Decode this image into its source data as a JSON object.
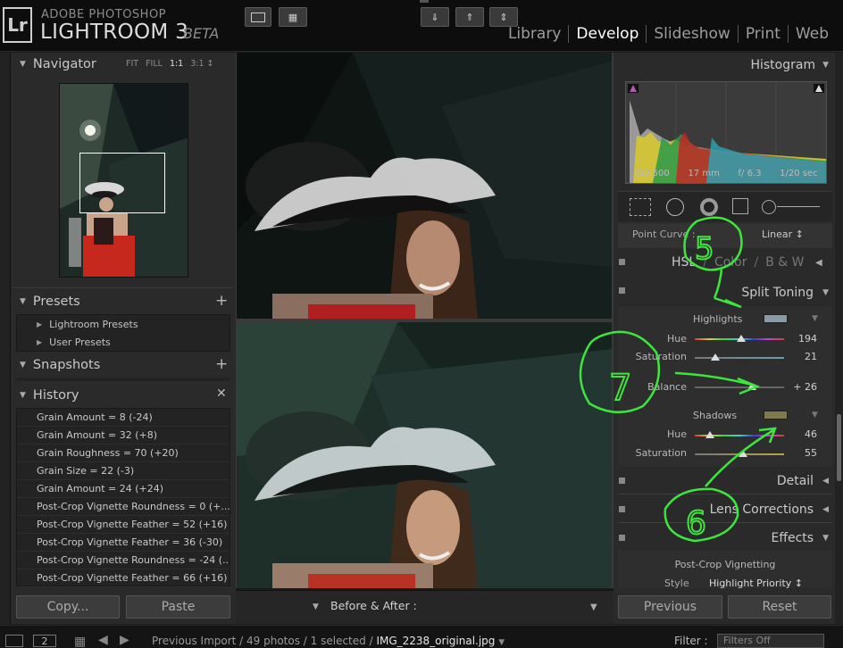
{
  "app": {
    "brand_top": "ADOBE PHOTOSHOP",
    "brand_main": "LIGHTROOM 3",
    "brand_beta": "BETA",
    "logo": "Lr"
  },
  "modules": [
    "Library",
    "Develop",
    "Slideshow",
    "Print",
    "Web"
  ],
  "active_module": "Develop",
  "navigator": {
    "title": "Navigator",
    "options": [
      "FIT",
      "FILL",
      "1:1",
      "3:1 ↕"
    ]
  },
  "presets": {
    "title": "Presets",
    "items": [
      "Lightroom Presets",
      "User Presets"
    ]
  },
  "snapshots": {
    "title": "Snapshots"
  },
  "history": {
    "title": "History",
    "items": [
      "Grain Amount = 8 (-24)",
      "Grain Amount = 32 (+8)",
      "Grain Roughness = 70 (+20)",
      "Grain Size = 22 (-3)",
      "Grain Amount = 24 (+24)",
      "Post-Crop Vignette Roundness = 0 (+...",
      "Post-Crop Vignette Feather = 52 (+16)",
      "Post-Crop Vignette Feather = 36 (-30)",
      "Post-Crop Vignette Roundness = -24 (...",
      "Post-Crop Vignette Feather = 66 (+16)"
    ]
  },
  "left_buttons": {
    "copy": "Copy...",
    "paste": "Paste"
  },
  "toolbar": {
    "before_after_label": "Before & After :"
  },
  "histogram": {
    "title": "Histogram",
    "iso": "ISO 500",
    "focal": "17 mm",
    "aperture": "f/ 6.3",
    "shutter": "1/20 sec"
  },
  "point_curve": {
    "label": "Point Curve :",
    "value": "Linear ↕"
  },
  "hsl_tabs": {
    "hsl": "HSL",
    "sep1": "/",
    "color": "Color",
    "sep2": "/",
    "bw": "B & W"
  },
  "split_toning": {
    "title": "Split Toning",
    "highlights_label": "Highlights",
    "highlights_color": "#8a9aa3",
    "highlights_hue_label": "Hue",
    "highlights_hue": "194",
    "highlights_sat_label": "Saturation",
    "highlights_sat": "21",
    "balance_label": "Balance",
    "balance": "+ 26",
    "shadows_label": "Shadows",
    "shadows_color": "#7f7a4e",
    "shadows_hue_label": "Hue",
    "shadows_hue": "46",
    "shadows_sat_label": "Saturation",
    "shadows_sat": "55"
  },
  "detail": {
    "title": "Detail"
  },
  "lens": {
    "title": "Lens Corrections"
  },
  "effects": {
    "title": "Effects",
    "sub": "Post-Crop Vignetting",
    "style_label": "Style",
    "style_value": "Highlight Priority ↕"
  },
  "right_buttons": {
    "previous": "Previous",
    "reset": "Reset"
  },
  "statusbar": {
    "page": "2",
    "path": "Previous Import / 49 photos / 1 selected /",
    "filename": "IMG_2238_original.jpg",
    "filter_label": "Filter :",
    "filter_value": "Filters Off"
  },
  "annotations": [
    "5",
    "7",
    "6"
  ],
  "colors": {
    "accent_green": "#3de63d",
    "panel": "#2a2a2a",
    "topbar": "#0d0d0d"
  }
}
